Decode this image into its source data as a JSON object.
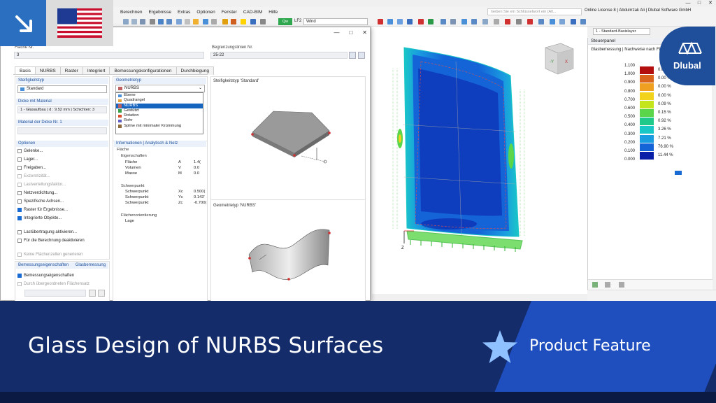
{
  "menu": [
    "Berechnen",
    "Ergebnisse",
    "Extras",
    "Optionen",
    "Fenster",
    "CAD-BIM",
    "Hilfe"
  ],
  "search_placeholder": "Geben Sie ein Schlüsselwort ein (Alt...",
  "license": "Online License 8 | Abdulrrzak Ali | Dlubal Software GmbH",
  "loadcase": {
    "code": "Qw",
    "id": "LF2",
    "name": "Wind"
  },
  "basis_dropdown": "1 - Standard-Basislayer",
  "dialog": {
    "surface_no_label": "Fläche Nr.",
    "surface_no": "3",
    "boundary_label": "Begrenzungslinien Nr.",
    "boundary_value": "25-22",
    "tabs": [
      "Basis",
      "NURBS",
      "Raster",
      "Integriert",
      "Bemessungskonfigurationen",
      "Durchbiegung"
    ],
    "stiffness_label": "Steifigkeitstyp",
    "stiffness_value": "Standard",
    "thickness_label": "Dicke mit Material",
    "thickness_value": "1 - Glasaufbau | d : 9.52 mm | Schichten: 3",
    "material_label": "Material der Dicke Nr. 1",
    "geometry_label": "Geometrietyp",
    "geometry_value": "NURBS",
    "geometry_options": [
      {
        "label": "Ebene",
        "color": "#4a90d9"
      },
      {
        "label": "Quadrangel",
        "color": "#e8a33a"
      },
      {
        "label": "NURBS",
        "color": "#c06060"
      },
      {
        "label": "Gestützt",
        "color": "#3aa04a"
      },
      {
        "label": "Rotation",
        "color": "#d94a2a"
      },
      {
        "label": "Rohr",
        "color": "#6060c0"
      },
      {
        "label": "Spline mit minimaler Krümmung",
        "color": "#8a6a3a"
      }
    ],
    "options_label": "Optionen",
    "options": [
      {
        "label": "Gelenke...",
        "checked": false,
        "disabled": false
      },
      {
        "label": "Lager...",
        "checked": false,
        "disabled": false
      },
      {
        "label": "Freigaben...",
        "checked": false,
        "disabled": false
      },
      {
        "label": "Exzentrizität...",
        "checked": false,
        "disabled": true
      },
      {
        "label": "Lastverteilungsfaktor...",
        "checked": false,
        "disabled": true
      },
      {
        "label": "Netzverdichtung...",
        "checked": false,
        "disabled": false
      },
      {
        "label": "Spezifische Achsen...",
        "checked": false,
        "disabled": false
      },
      {
        "label": "Raster für Ergebnisse...",
        "checked": true,
        "disabled": false
      },
      {
        "label": "Integrierte Objekte...",
        "checked": true,
        "disabled": false
      },
      {
        "label": "Lastübertragung aktivieren...",
        "checked": false,
        "disabled": false
      },
      {
        "label": "Für die Berechnung deaktivieren",
        "checked": false,
        "disabled": false
      },
      {
        "label": "Keine Flächenzellen generieren",
        "checked": false,
        "disabled": true
      }
    ],
    "design_props_label": "Bemessungseigenschaften",
    "glass_design_label": "Glasbemessung",
    "design_checks": [
      {
        "label": "Bemessungseigenschaften",
        "checked": true,
        "disabled": false
      },
      {
        "label": "Durch übergeordneten Flächensatz",
        "checked": false,
        "disabled": true
      }
    ],
    "info_label": "Informationen | Analytisch & Netz",
    "info_rows": [
      {
        "indent": 0,
        "name": "Fläche",
        "sym": "",
        "val": ""
      },
      {
        "indent": 1,
        "name": "Eigenschaften",
        "sym": "",
        "val": ""
      },
      {
        "indent": 2,
        "name": "Fläche",
        "sym": "A",
        "val": "1.4("
      },
      {
        "indent": 2,
        "name": "Volumen",
        "sym": "V",
        "val": "0.0"
      },
      {
        "indent": 2,
        "name": "Masse",
        "sym": "M",
        "val": "0.0"
      },
      {
        "indent": 1,
        "name": "Schwerpunkt",
        "sym": "",
        "val": ""
      },
      {
        "indent": 2,
        "name": "Schwerpunkt",
        "sym": "Xc",
        "val": "0.500("
      },
      {
        "indent": 2,
        "name": "Schwerpunkt",
        "sym": "Yc",
        "val": "0.143'"
      },
      {
        "indent": 2,
        "name": "Schwerpunkt",
        "sym": "Zc",
        "val": "-0.700("
      },
      {
        "indent": 1,
        "name": "Flächenorientierung",
        "sym": "",
        "val": ""
      },
      {
        "indent": 2,
        "name": "Lage",
        "sym": "",
        "val": ""
      }
    ],
    "preview_title_1": "Steifigkeitstyp 'Standard'",
    "preview_title_2": "Geometrietyp 'NURBS'"
  },
  "panel": {
    "title": "Steuerpanel",
    "subtitle": "Glasbemessung | Nachweise nach Fl...",
    "legend": [
      {
        "value": "1.100",
        "pct": "0.00 %",
        "color": "#b40f0f"
      },
      {
        "value": "1.000",
        "pct": "0.00 %",
        "color": "#d9661c"
      },
      {
        "value": "0.900",
        "pct": "0.00 %",
        "color": "#f0a020"
      },
      {
        "value": "0.800",
        "pct": "0.00 %",
        "color": "#f3d21c"
      },
      {
        "value": "0.700",
        "pct": "0.09 %",
        "color": "#c4e41c"
      },
      {
        "value": "0.600",
        "pct": "0.15 %",
        "color": "#5bd64a"
      },
      {
        "value": "0.500",
        "pct": "0.92 %",
        "color": "#1fc98a"
      },
      {
        "value": "0.400",
        "pct": "3.26 %",
        "color": "#19c7c7"
      },
      {
        "value": "0.300",
        "pct": "7.21 %",
        "color": "#1a9de0"
      },
      {
        "value": "0.200",
        "pct": "76.90 %",
        "color": "#1464d8"
      },
      {
        "value": "0.100",
        "pct": "11.44 %",
        "color": "#0a1fa8"
      },
      {
        "value": "0.000",
        "pct": "",
        "color": ""
      }
    ]
  },
  "brand": "Dlubal",
  "banner": {
    "title": "Glass Design of NURBS Surfaces",
    "tag": "Product Feature"
  }
}
